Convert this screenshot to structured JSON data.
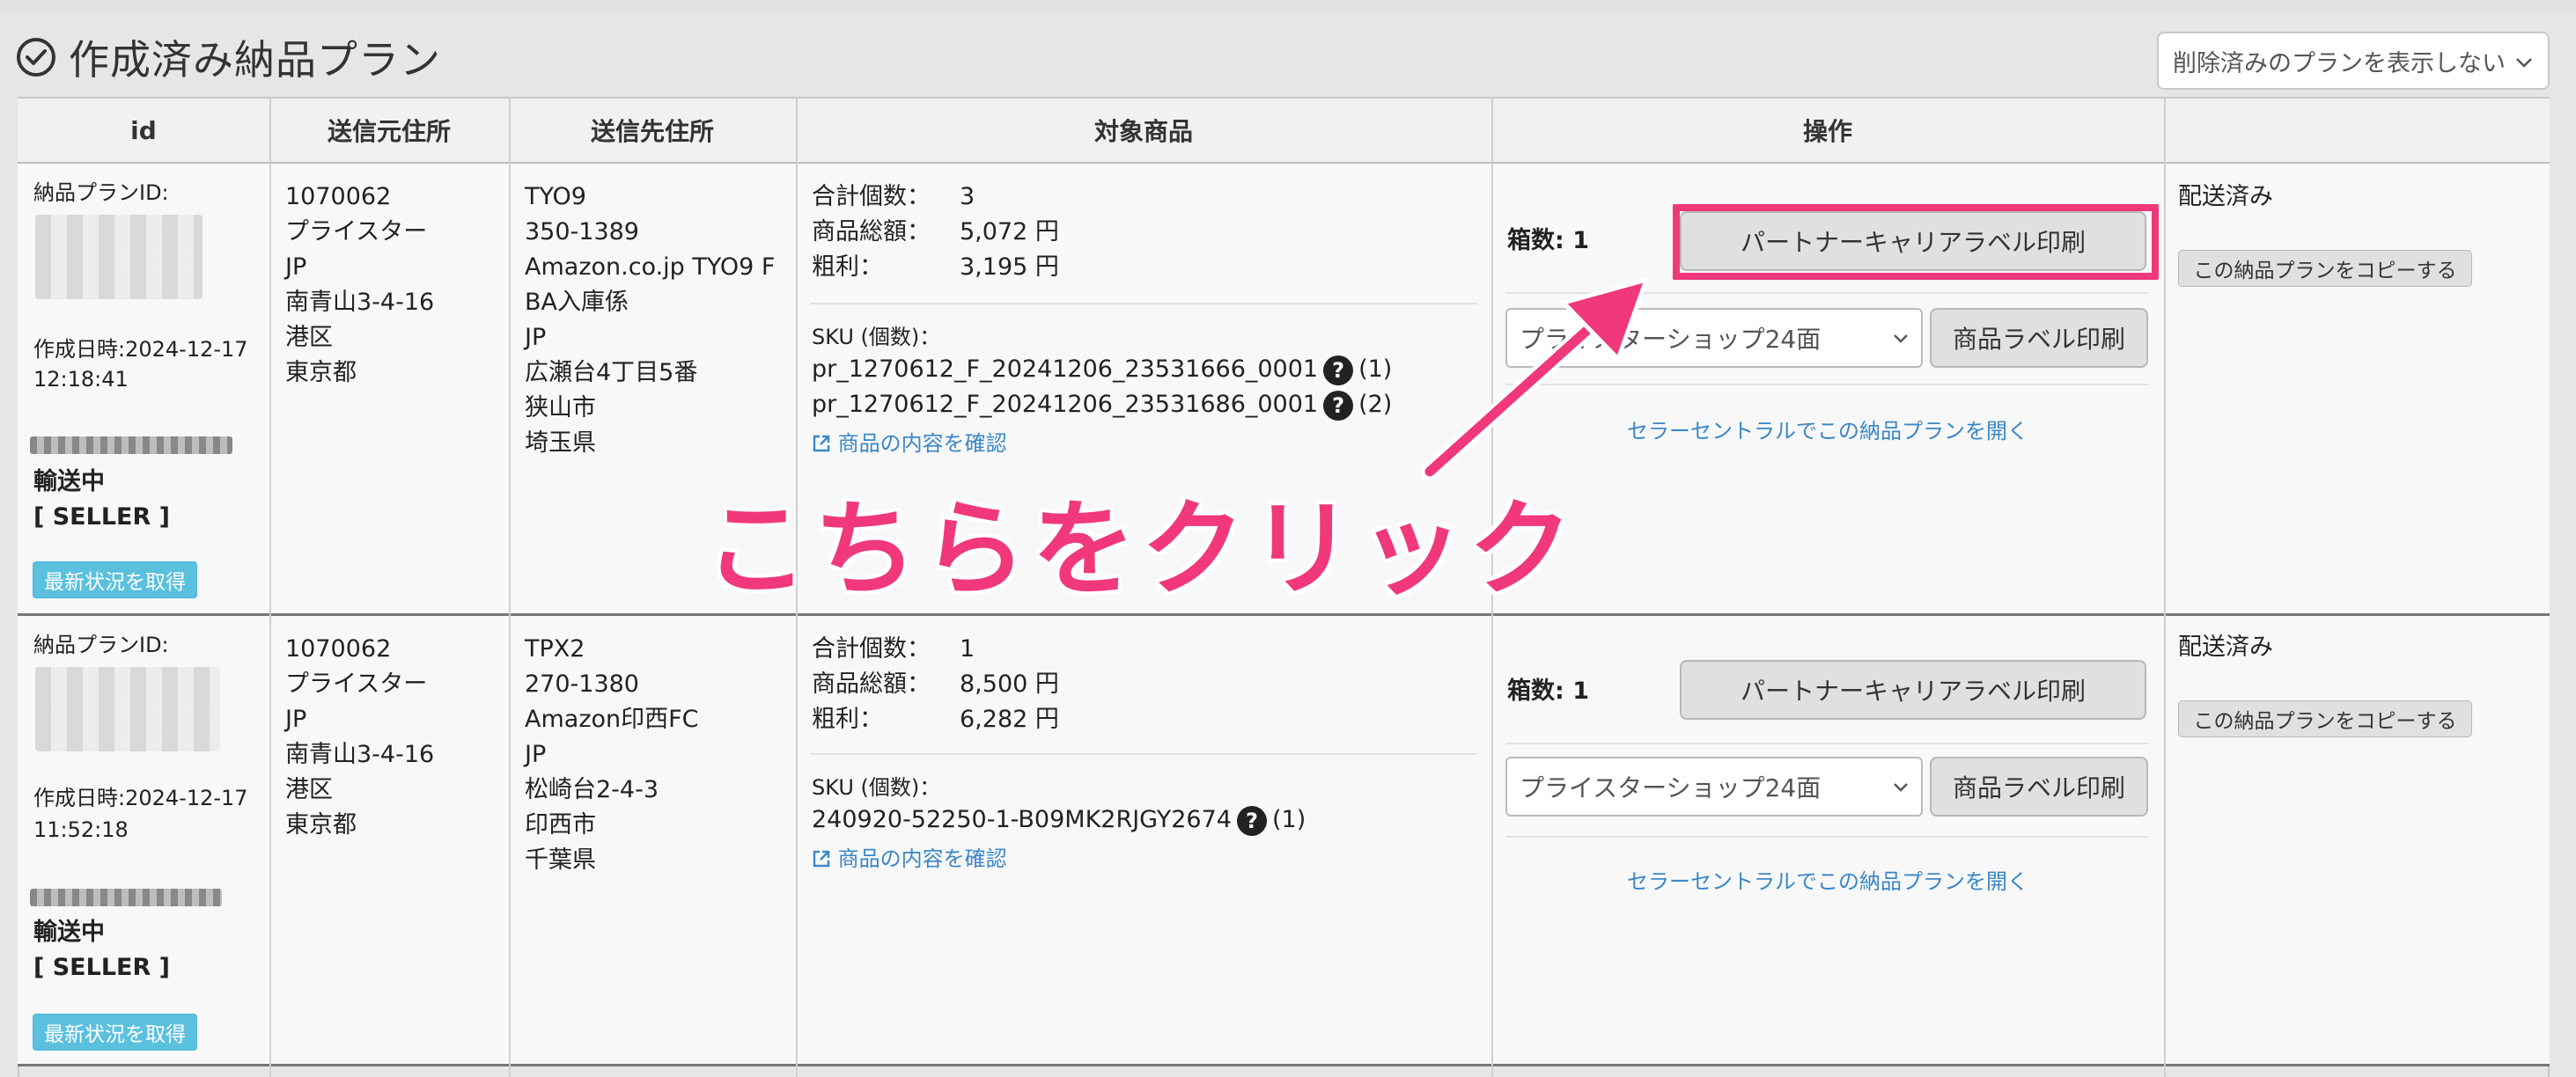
{
  "page": {
    "title": "作成済み納品プラン",
    "filter_select": "削除済みのプランを表示しない"
  },
  "columns": [
    "id",
    "送信元住所",
    "送信先住所",
    "対象商品",
    "操作",
    ""
  ],
  "rows": [
    {
      "plan_id_label": "納品プランID:",
      "created_label": "作成日時:2024-12-17",
      "created_time": "12:18:41",
      "status": "輸送中",
      "role": "[ SELLER ]",
      "refresh_button": "最新状況を取得",
      "from": [
        "1070062",
        "プライスター",
        "JP",
        "南青山3-4-16",
        "港区",
        "東京都"
      ],
      "to": [
        "TYO9",
        "350-1389",
        "Amazon.co.jp TYO9 F",
        "BA入庫係",
        "JP",
        "広瀬台4丁目5番",
        "狭山市",
        "埼玉県"
      ],
      "summary": [
        {
          "label": "合計個数：",
          "value": "3"
        },
        {
          "label": "商品総額：",
          "value": "5,072 円"
        },
        {
          "label": "粗利：",
          "value": "3,195 円"
        }
      ],
      "sku_label": "SKU (個数)：",
      "skus": [
        {
          "sku": "pr_1270612_F_20241206_23531666_0001",
          "qty": "(1)"
        },
        {
          "sku": "pr_1270612_F_20241206_23531686_0001",
          "qty": "(2)"
        }
      ],
      "item_link": "商品の内容を確認",
      "boxes": "箱数: 1",
      "carrier_button": "パートナーキャリアラベル印刷",
      "shop_select": "プライスターショップ24面",
      "label_button": "商品ラベル印刷",
      "seller_central_link": "セラーセントラルでこの納品プランを開く",
      "ship_status": "配送済み",
      "copy_button": "この納品プランをコピーする"
    },
    {
      "plan_id_label": "納品プランID:",
      "created_label": "作成日時:2024-12-17",
      "created_time": "11:52:18",
      "status": "輸送中",
      "role": "[ SELLER ]",
      "refresh_button": "最新状況を取得",
      "from": [
        "1070062",
        "プライスター",
        "JP",
        "南青山3-4-16",
        "港区",
        "東京都"
      ],
      "to": [
        "TPX2",
        "270-1380",
        "Amazon印西FC",
        "JP",
        "松崎台2-4-3",
        "印西市",
        "千葉県"
      ],
      "summary": [
        {
          "label": "合計個数：",
          "value": "1"
        },
        {
          "label": "商品総額：",
          "value": "8,500 円"
        },
        {
          "label": "粗利：",
          "value": "6,282 円"
        }
      ],
      "sku_label": "SKU (個数)：",
      "skus": [
        {
          "sku": "240920-52250-1-B09MK2RJGY2674",
          "qty": "(1)"
        }
      ],
      "item_link": "商品の内容を確認",
      "boxes": "箱数: 1",
      "carrier_button": "パートナーキャリアラベル印刷",
      "shop_select": "プライスターショップ24面",
      "label_button": "商品ラベル印刷",
      "seller_central_link": "セラーセントラルでこの納品プランを開く",
      "ship_status": "配送済み",
      "copy_button": "この納品プランをコピーする"
    }
  ],
  "annotation": {
    "text": "こちらをクリック",
    "color": "#f0387a"
  },
  "icons": {
    "title": "check-circle-icon",
    "select": "chevron-down-icon",
    "sku_help": "question-circle-icon",
    "link": "external-link-icon"
  }
}
